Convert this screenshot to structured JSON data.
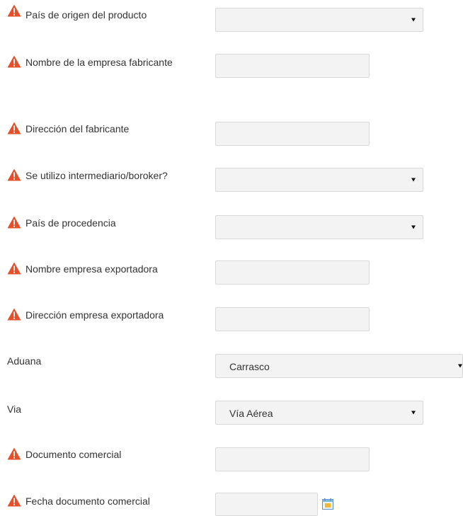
{
  "colors": {
    "warning": "#e5502a",
    "field_bg": "#f3f3f3",
    "field_border": "#d9d9d9"
  },
  "fields": {
    "pais_origen": {
      "label": "País de origen del producto",
      "value": ""
    },
    "nombre_fabricante": {
      "label": "Nombre de la empresa fabricante",
      "value": ""
    },
    "direccion_fabricante": {
      "label": "Dirección del fabricante",
      "value": ""
    },
    "intermediario": {
      "label": "Se utilizo intermediario/boroker?",
      "value": ""
    },
    "pais_procedencia": {
      "label": "País de procedencia",
      "value": ""
    },
    "nombre_exportadora": {
      "label": "Nombre empresa exportadora",
      "value": ""
    },
    "direccion_exportadora": {
      "label": "Dirección empresa exportadora",
      "value": ""
    },
    "aduana": {
      "label": "Aduana",
      "value": "Carrasco"
    },
    "via": {
      "label": "Via",
      "value": "Vía Aérea"
    },
    "documento_comercial": {
      "label": "Documento comercial",
      "value": ""
    },
    "fecha_documento": {
      "label": "Fecha documento comercial",
      "value": ""
    }
  },
  "icons": {
    "required": "warning-triangle-icon",
    "calendar": "calendar-icon",
    "dropdown": "chevron-down-icon"
  }
}
